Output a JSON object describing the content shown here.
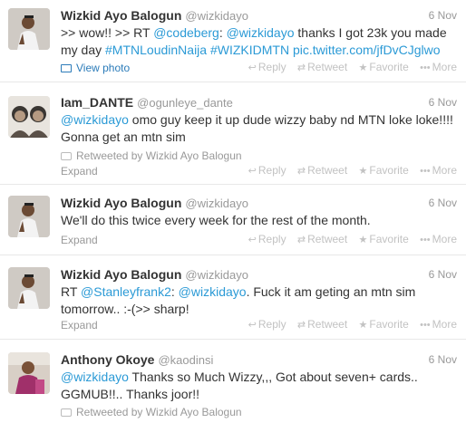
{
  "action_labels": {
    "reply": "Reply",
    "retweet": "Retweet",
    "favorite": "Favorite",
    "more": "More"
  },
  "tweets": [
    {
      "fullname": "Wizkid Ayo Balogun",
      "username": "@wizkidayo",
      "time": "6 Nov",
      "parts": [
        {
          "t": ">> wow!! >> RT "
        },
        {
          "t": "@codeberg",
          "link": true
        },
        {
          "t": ": "
        },
        {
          "t": "@wizkidayo",
          "link": true
        },
        {
          "t": " thanks I got 23k you made my day "
        },
        {
          "t": "#MTNLoudinNaija",
          "link": true
        },
        {
          "t": " "
        },
        {
          "t": "#WIZKIDMTN",
          "link": true
        },
        {
          "t": " "
        },
        {
          "t": "pic.twitter.com/jfDvCJglwo",
          "link": true
        }
      ],
      "footer_link": "View photo",
      "retweeted_by": ""
    },
    {
      "fullname": "Iam_DANTE",
      "username": "@ogunleye_dante",
      "time": "6 Nov",
      "parts": [
        {
          "t": "@wizkidayo",
          "link": true
        },
        {
          "t": " omo guy keep it up dude wizzy baby nd MTN loke loke!!!! Gonna get an mtn sim"
        }
      ],
      "retweeted_by": "Retweeted by Wizkid Ayo Balogun",
      "footer_link": "Expand"
    },
    {
      "fullname": "Wizkid Ayo Balogun",
      "username": "@wizkidayo",
      "time": "6 Nov",
      "parts": [
        {
          "t": "We'll do this twice every week for the rest of the month."
        }
      ],
      "retweeted_by": "",
      "footer_link": "Expand"
    },
    {
      "fullname": "Wizkid Ayo Balogun",
      "username": "@wizkidayo",
      "time": "6 Nov",
      "parts": [
        {
          "t": "RT "
        },
        {
          "t": "@Stanleyfrank2",
          "link": true
        },
        {
          "t": ": "
        },
        {
          "t": "@wizkidayo",
          "link": true
        },
        {
          "t": ". Fuck it am geting an mtn sim tomorrow.. :-(>> sharp!"
        }
      ],
      "retweeted_by": "",
      "footer_link": "Expand"
    },
    {
      "fullname": "Anthony Okoye",
      "username": "@kaodinsi",
      "time": "6 Nov",
      "parts": [
        {
          "t": "@wizkidayo",
          "link": true
        },
        {
          "t": " Thanks so Much Wizzy,,, Got about seven+  cards.. GGMUB!!.. Thanks joor!!"
        }
      ],
      "retweeted_by": "Retweeted by Wizkid Ayo Balogun",
      "footer_link": ""
    }
  ]
}
